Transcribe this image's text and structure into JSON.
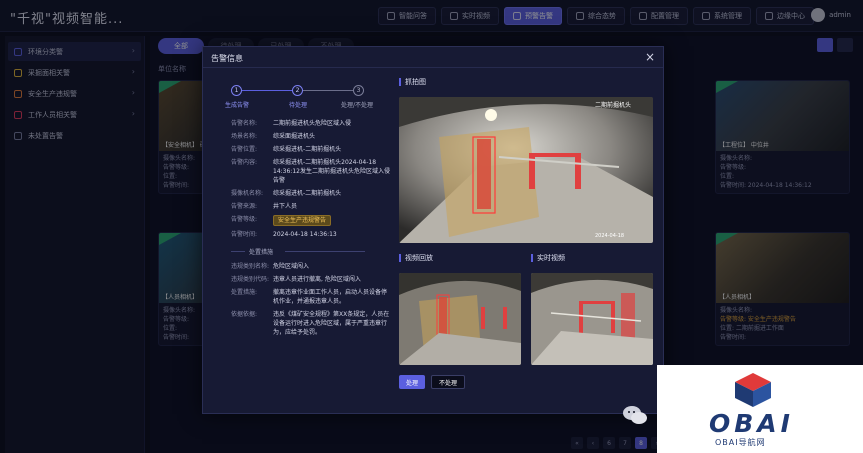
{
  "header": {
    "title": "\"千视\"视频智能...",
    "nav": [
      {
        "label": "智能问答",
        "icon": "chat-icon"
      },
      {
        "label": "实时视频",
        "icon": "video-icon"
      },
      {
        "label": "预警告警",
        "icon": "alarm-icon",
        "active": true
      },
      {
        "label": "综合态势",
        "icon": "dashboard-icon"
      },
      {
        "label": "配置管理",
        "icon": "config-icon"
      },
      {
        "label": "系统管理",
        "icon": "settings-icon"
      },
      {
        "label": "边缘中心",
        "icon": "edge-icon"
      }
    ],
    "user": "admin"
  },
  "sidebar": {
    "items": [
      {
        "label": "环境分类警",
        "color": "#5b5fe0"
      },
      {
        "label": "采掘面相关警",
        "color": "#e0b43a"
      },
      {
        "label": "安全生产违规警",
        "color": "#e07a3a"
      },
      {
        "label": "工作人员相关警",
        "color": "#e03a5a"
      },
      {
        "label": "未处置告警",
        "color": "#7a7ea0"
      }
    ]
  },
  "main": {
    "tabs": [
      "全部",
      "待处理",
      "已处理",
      "不处理"
    ],
    "filter_label": "单位名称",
    "pager": [
      "«",
      "‹",
      "6",
      "7",
      "8",
      "›"
    ]
  },
  "cards": [
    {
      "caption": "【安全相机】 矿区",
      "meta1": "摄像头名称:",
      "meta2": "告警等级:",
      "meta3": "位置:",
      "meta4": "告警时间:"
    },
    {
      "caption": "【工程位】 中位井",
      "meta1": "摄像头名称:",
      "meta2": "告警等级:",
      "meta3": "位置:",
      "meta4": "告警时间: 2024-04-18 14:36:12"
    },
    {
      "caption": "【人员相机】",
      "meta1": "摄像头名称:",
      "meta2": "告警等级:",
      "meta3": "位置:",
      "meta4": "告警时间:"
    },
    {
      "caption": "【人员相机】",
      "meta1": "摄像头名称:",
      "meta2": "告警等级: 安全生产违规警告",
      "meta3": "位置: 二期前掘进工作面",
      "meta4": "告警时间:"
    }
  ],
  "modal": {
    "title": "告警信息",
    "close": "×",
    "steps": [
      {
        "num": "1",
        "label": "生成告警"
      },
      {
        "num": "2",
        "label": "待处理"
      },
      {
        "num": "3",
        "label": "处理/不处理"
      }
    ],
    "info": [
      {
        "label": "告警名称:",
        "value": "二期前掘进机头危险区域入侵"
      },
      {
        "label": "场景名称:",
        "value": "综采面掘进机头"
      },
      {
        "label": "告警位置:",
        "value": "综采掘进机-二期前掘机头"
      },
      {
        "label": "告警内容:",
        "value": "综采掘进机-二期前掘机头2024-04-18 14:36:12发生二期前掘进机头危险区域入侵告警"
      },
      {
        "label": "摄像机名称:",
        "value": "综采掘进机-二期前掘机头"
      },
      {
        "label": "告警来源:",
        "value": "井下人员"
      },
      {
        "label": "告警等级:",
        "value": "安全生产违规警告",
        "badge": true
      },
      {
        "label": "告警时间:",
        "value": "2024-04-18 14:36:13"
      }
    ],
    "section": "处置措施",
    "disposal": [
      {
        "label": "违规类别名称:",
        "value": "危险区域闯入"
      },
      {
        "label": "违规类别代码:",
        "value": "违章人员进行撤离, 危险区域闯入"
      },
      {
        "label": "处置措施:",
        "value": "撤离违章作业面工作人员，启动人员设备停机作业，并通报违章人员。"
      },
      {
        "label": "依据依据:",
        "value": "违反《煤矿安全规程》第XX条规定，人员在设备运行时进入危险区域，属于严重违章行为，应给予处罚。"
      }
    ],
    "pic_title": "抓拍图",
    "video_title": "视频回放",
    "live_title": "实时视频",
    "stamp": "二期前掘机头",
    "ts": "2024-04-18",
    "btn_process": "处理",
    "btn_ignore": "不处理"
  },
  "watermark": {
    "brand": "OBAI",
    "sub": "OBAI导航网"
  }
}
